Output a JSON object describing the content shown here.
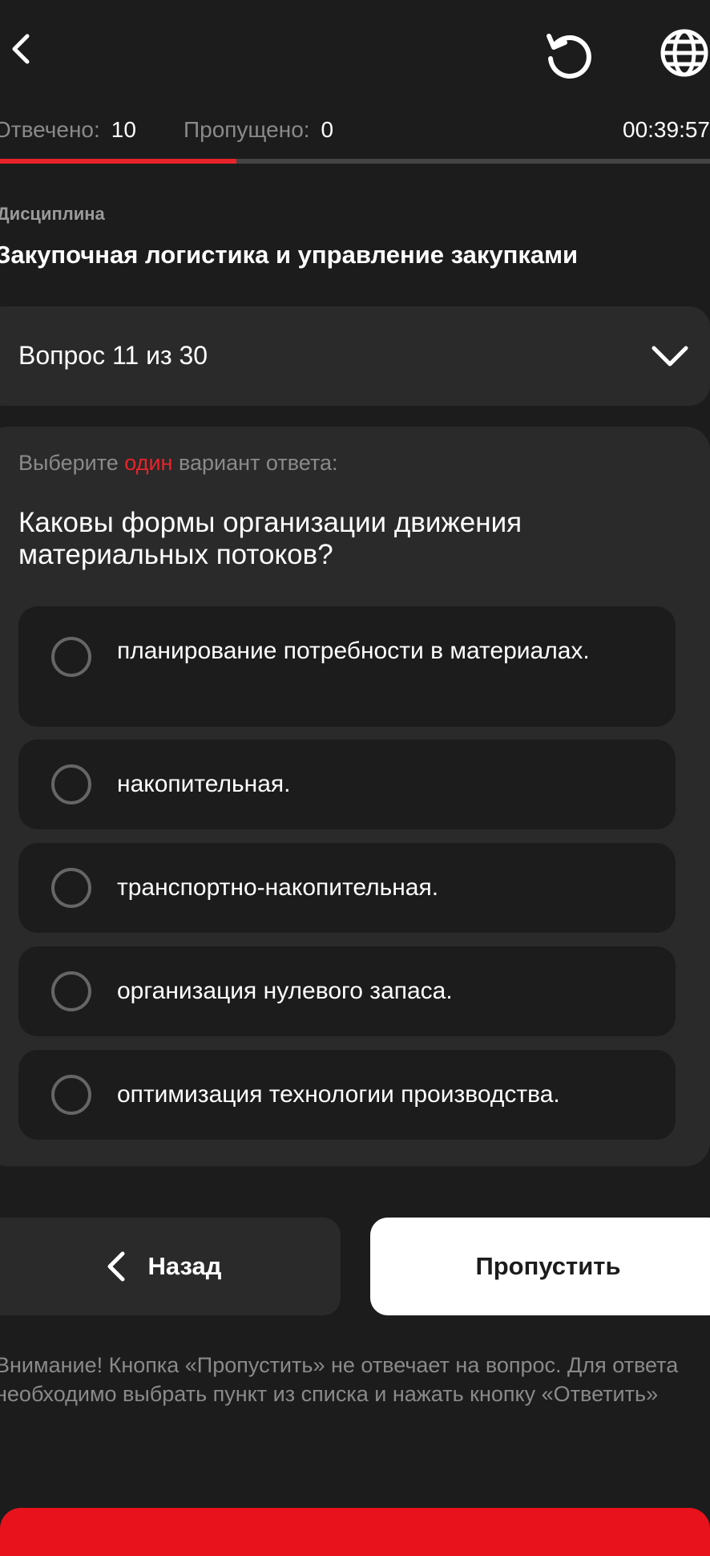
{
  "header": {
    "back_icon": "chevron-left-icon",
    "reset_icon": "reset-icon",
    "language_icon": "globe-icon"
  },
  "stats": {
    "answered_label": "Отвечено:",
    "answered_value": "10",
    "skipped_label": "Пропущено:",
    "skipped_value": "0",
    "timer": "00:39:57"
  },
  "progress": {
    "fraction": 0.3333
  },
  "discipline": {
    "label": "Дисциплина",
    "name": "Закупочная логистика и управление закупками"
  },
  "question_selector": {
    "label": "Вопрос 11 из 30"
  },
  "question": {
    "instruction_prefix": "Выберите",
    "instruction_accent": "один",
    "instruction_suffix": "вариант ответа:",
    "text": "Каковы формы организации движения материальных потоков?",
    "options": [
      {
        "label": "планирование потребности в материалах."
      },
      {
        "label": "накопительная."
      },
      {
        "label": "транспортно-накопительная."
      },
      {
        "label": "организация нулевого запаса."
      },
      {
        "label": "оптимизация технологии производства."
      }
    ]
  },
  "buttons": {
    "back_label": "Назад",
    "skip_label": "Пропустить"
  },
  "notice": "Внимание! Кнопка «Пропустить» не отвечает на вопрос. Для ответа необходимо выбрать пункт из списка и нажать кнопку «Ответить»",
  "colors": {
    "accent": "#e8232a",
    "background": "#1c1c1c",
    "card": "#2a2a2a"
  }
}
